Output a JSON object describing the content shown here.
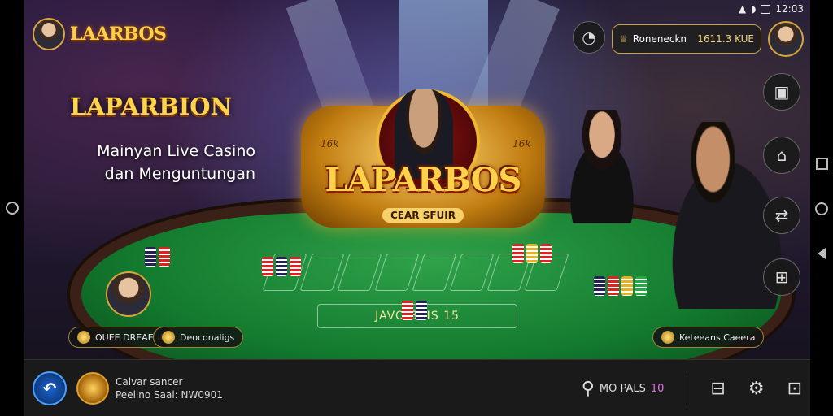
{
  "status": {
    "time": "12:03"
  },
  "brand": {
    "logo": "LAARBOS"
  },
  "promo": {
    "title": "LAPARBION",
    "line1": "Mainyan Live Casino",
    "line2": "dan Menguntungan"
  },
  "emblem": {
    "name": "LAPARBOS",
    "sub": "CEAR SFUIR",
    "badge_left": "16k",
    "badge_right": "16k"
  },
  "top_pill": {
    "label": "Roneneckn",
    "value": "1611.3 KUE"
  },
  "table": {
    "bet_label": "JAVO BAIS 15"
  },
  "left_pills": {
    "pill1": "OUEE DREAEUE",
    "pill2": "Deoconaligs"
  },
  "right_pill": {
    "label": "Keteeans Caeera"
  },
  "bottom": {
    "user_name": "Calvar sancer",
    "user_detail": "Peelino Saal: NW0901",
    "mode_label": "MO PALS",
    "mode_count": "10"
  }
}
